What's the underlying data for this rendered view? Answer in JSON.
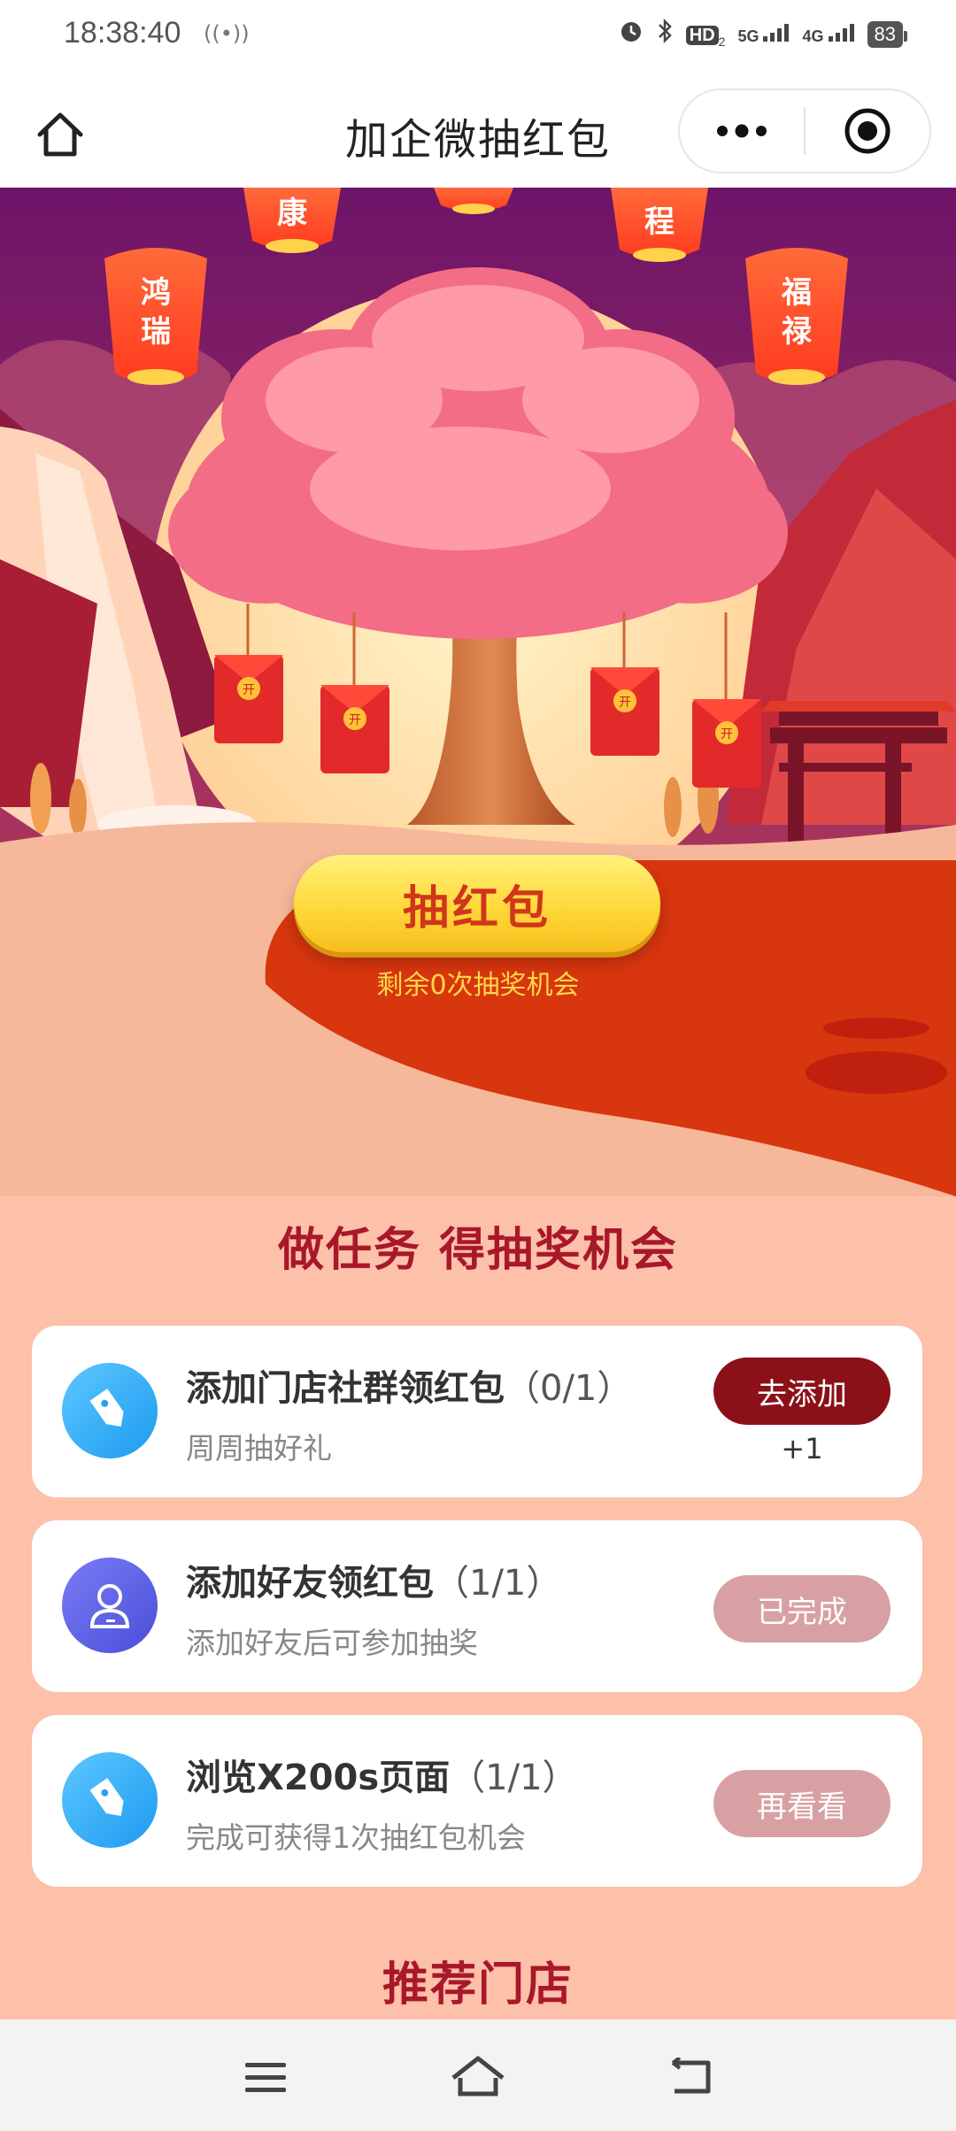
{
  "status_bar": {
    "time": "18:38:40",
    "net_icon": "((•))",
    "hd": "HD",
    "hd_sub": "2",
    "sig1": "5G",
    "sig2": "4G",
    "battery": "83"
  },
  "nav": {
    "title": "加企微抽红包"
  },
  "hero": {
    "lanterns": [
      "康",
      "程",
      "鸿瑞",
      "福禄"
    ],
    "draw_button": "抽红包",
    "remaining": "剩余0次抽奖机会",
    "envelope_mark": "开"
  },
  "tasks_section": {
    "title": "做任务 得抽奖机会",
    "items": [
      {
        "title": "添加门店社群领红包",
        "count": "（0/1）",
        "subtitle": "周周抽好礼",
        "button": "去添加",
        "bonus": "+1",
        "state": "active",
        "icon": "tag-icon"
      },
      {
        "title": "添加好友领红包",
        "count": "（1/1）",
        "subtitle": "添加好友后可参加抽奖",
        "button": "已完成",
        "state": "done",
        "icon": "user-icon"
      },
      {
        "title": "浏览X200s页面",
        "count": "（1/1）",
        "subtitle": "完成可获得1次抽红包机会",
        "button": "再看看",
        "state": "done",
        "icon": "tag-icon"
      }
    ]
  },
  "stores_section": {
    "title": "推荐门店"
  },
  "colors": {
    "page_bg": "#fdc0a8",
    "accent": "#8c1018",
    "title_red": "#a8182a",
    "button_yellow": "#ffd83a"
  }
}
